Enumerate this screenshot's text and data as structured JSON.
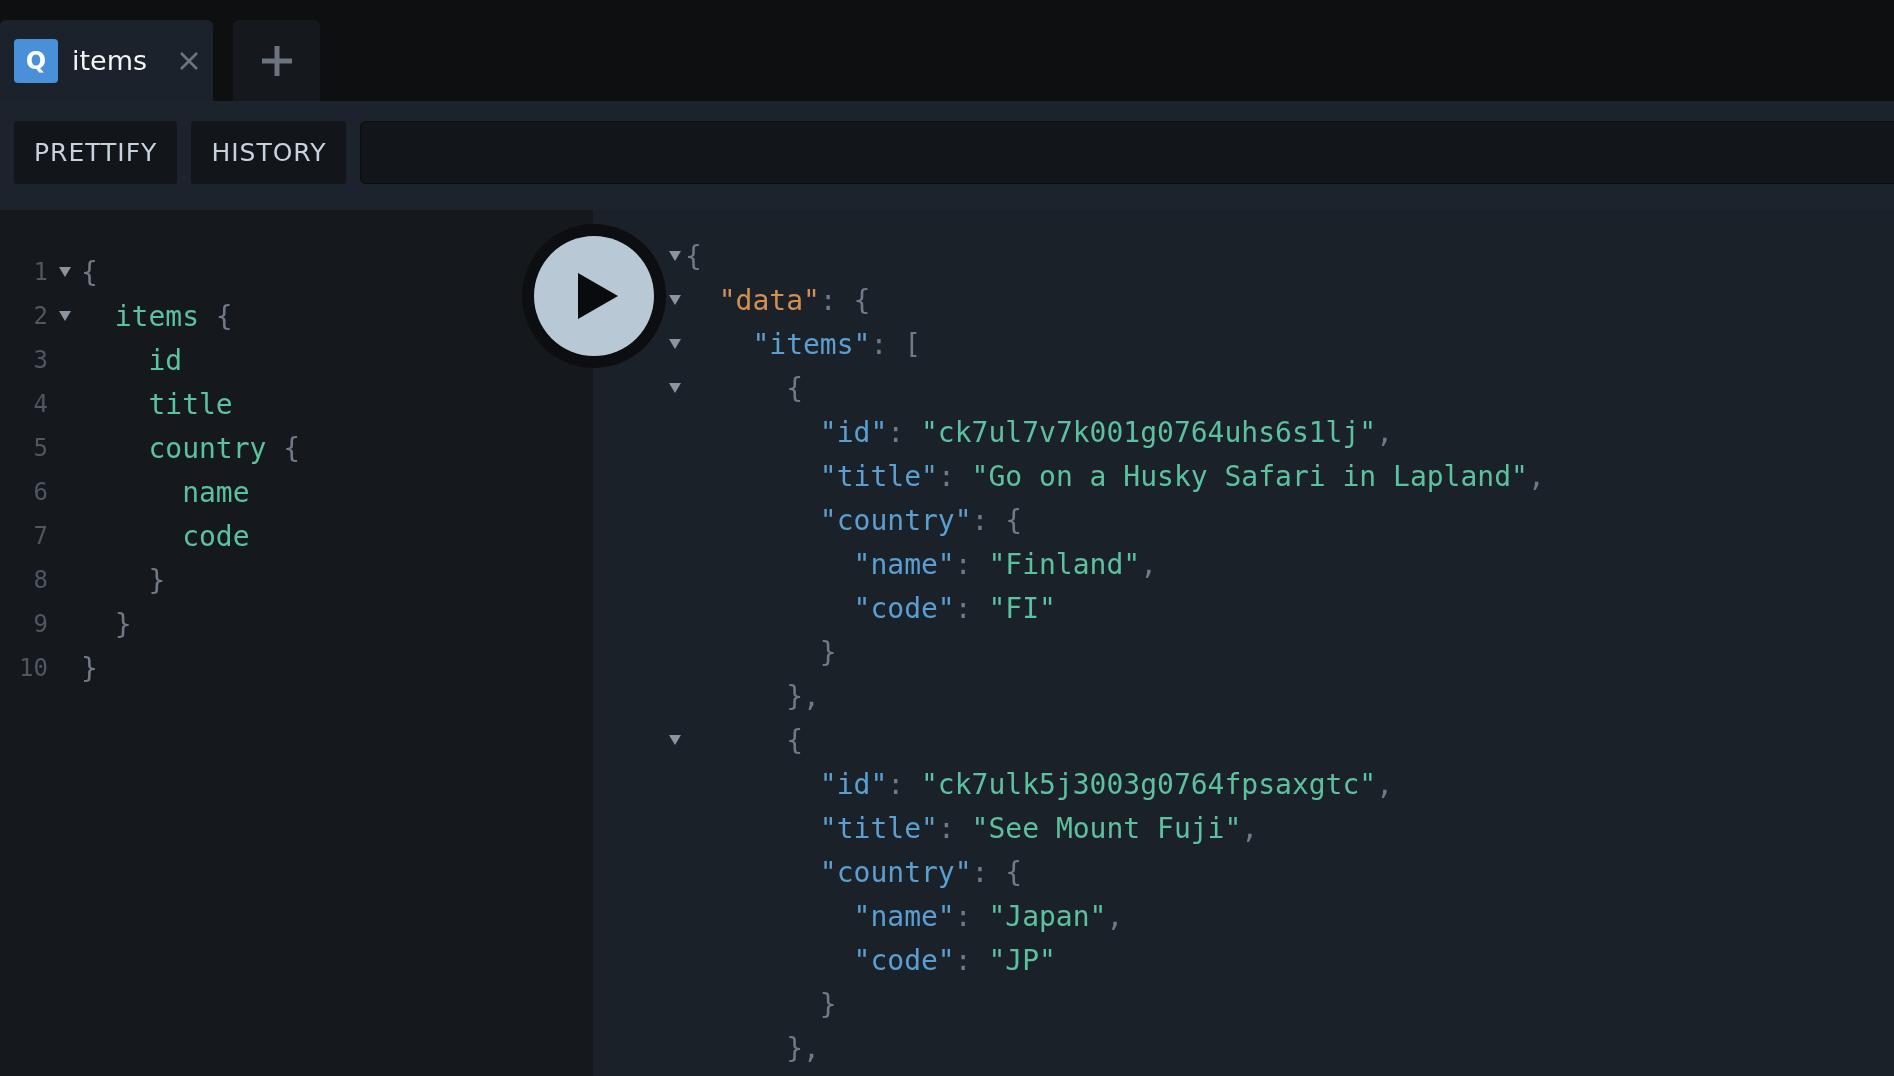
{
  "tabs": [
    {
      "badge": "Q",
      "label": "items",
      "selected": true
    }
  ],
  "toolbar": {
    "buttons": [
      "PRETTIFY",
      "HISTORY"
    ]
  },
  "query_editor": {
    "lines": [
      {
        "number": "1",
        "foldable": true,
        "tokens": [
          {
            "kind": "punct",
            "text": "{"
          }
        ],
        "children": [
          {
            "number": "2",
            "foldable": true,
            "tokens": [
              {
                "kind": "field",
                "text": "items"
              },
              {
                "kind": "punct",
                "text": " {"
              }
            ],
            "children": [
              {
                "number": "3",
                "foldable": false,
                "tokens": [
                  {
                    "kind": "field",
                    "text": "id"
                  }
                ]
              },
              {
                "number": "4",
                "foldable": false,
                "tokens": [
                  {
                    "kind": "field",
                    "text": "title"
                  }
                ]
              },
              {
                "number": "5",
                "foldable": false,
                "tokens": [
                  {
                    "kind": "field",
                    "text": "country"
                  },
                  {
                    "kind": "punct",
                    "text": " {"
                  }
                ],
                "children": [
                  {
                    "number": "6",
                    "foldable": false,
                    "tokens": [
                      {
                        "kind": "field",
                        "text": "name"
                      }
                    ]
                  },
                  {
                    "number": "7",
                    "foldable": false,
                    "tokens": [
                      {
                        "kind": "field",
                        "text": "code"
                      }
                    ]
                  }
                ],
                "end": {
                  "number": "8",
                  "tokens": [
                    {
                      "kind": "punct",
                      "text": "}"
                    }
                  ]
                }
              }
            ],
            "end": {
              "number": "9",
              "tokens": [
                {
                  "kind": "punct",
                  "text": "}"
                }
              ]
            }
          }
        ],
        "end": {
          "number": "10",
          "tokens": [
            {
              "kind": "punct",
              "text": "}"
            }
          ]
        }
      }
    ]
  },
  "result": {
    "lines": [
      {
        "foldable": true,
        "tokens": [
          {
            "kind": "punct",
            "text": "{"
          }
        ],
        "children": [
          {
            "foldable": true,
            "tokens": [
              {
                "kind": "root_key",
                "text": "\"data\""
              },
              {
                "kind": "punct",
                "text": ": {"
              }
            ],
            "children": [
              {
                "foldable": true,
                "tokens": [
                  {
                    "kind": "key",
                    "text": "\"items\""
                  },
                  {
                    "kind": "punct",
                    "text": ": ["
                  }
                ],
                "children": [
                  {
                    "foldable": true,
                    "tokens": [
                      {
                        "kind": "punct",
                        "text": "{"
                      }
                    ],
                    "children": [
                      {
                        "foldable": false,
                        "tokens": [
                          {
                            "kind": "key",
                            "text": "\"id\""
                          },
                          {
                            "kind": "punct",
                            "text": ": "
                          },
                          {
                            "kind": "string",
                            "text": "\"ck7ul7v7k001g0764uhs6s1lj\""
                          },
                          {
                            "kind": "punct",
                            "text": ","
                          }
                        ]
                      },
                      {
                        "foldable": false,
                        "tokens": [
                          {
                            "kind": "key",
                            "text": "\"title\""
                          },
                          {
                            "kind": "punct",
                            "text": ": "
                          },
                          {
                            "kind": "string",
                            "text": "\"Go on a Husky Safari in Lapland\""
                          },
                          {
                            "kind": "punct",
                            "text": ","
                          }
                        ]
                      },
                      {
                        "foldable": false,
                        "tokens": [
                          {
                            "kind": "key",
                            "text": "\"country\""
                          },
                          {
                            "kind": "punct",
                            "text": ": {"
                          }
                        ],
                        "children": [
                          {
                            "foldable": false,
                            "tokens": [
                              {
                                "kind": "key",
                                "text": "\"name\""
                              },
                              {
                                "kind": "punct",
                                "text": ": "
                              },
                              {
                                "kind": "string",
                                "text": "\"Finland\""
                              },
                              {
                                "kind": "punct",
                                "text": ","
                              }
                            ]
                          },
                          {
                            "foldable": false,
                            "tokens": [
                              {
                                "kind": "key",
                                "text": "\"code\""
                              },
                              {
                                "kind": "punct",
                                "text": ": "
                              },
                              {
                                "kind": "string",
                                "text": "\"FI\""
                              }
                            ]
                          }
                        ],
                        "end": {
                          "tokens": [
                            {
                              "kind": "punct",
                              "text": "}"
                            }
                          ]
                        }
                      }
                    ],
                    "end": {
                      "tokens": [
                        {
                          "kind": "punct",
                          "text": "},"
                        }
                      ]
                    }
                  },
                  {
                    "foldable": true,
                    "tokens": [
                      {
                        "kind": "punct",
                        "text": "{"
                      }
                    ],
                    "children": [
                      {
                        "foldable": false,
                        "tokens": [
                          {
                            "kind": "key",
                            "text": "\"id\""
                          },
                          {
                            "kind": "punct",
                            "text": ": "
                          },
                          {
                            "kind": "string",
                            "text": "\"ck7ulk5j3003g0764fpsaxgtc\""
                          },
                          {
                            "kind": "punct",
                            "text": ","
                          }
                        ]
                      },
                      {
                        "foldable": false,
                        "tokens": [
                          {
                            "kind": "key",
                            "text": "\"title\""
                          },
                          {
                            "kind": "punct",
                            "text": ": "
                          },
                          {
                            "kind": "string",
                            "text": "\"See Mount Fuji\""
                          },
                          {
                            "kind": "punct",
                            "text": ","
                          }
                        ]
                      },
                      {
                        "foldable": false,
                        "tokens": [
                          {
                            "kind": "key",
                            "text": "\"country\""
                          },
                          {
                            "kind": "punct",
                            "text": ": {"
                          }
                        ],
                        "children": [
                          {
                            "foldable": false,
                            "tokens": [
                              {
                                "kind": "key",
                                "text": "\"name\""
                              },
                              {
                                "kind": "punct",
                                "text": ": "
                              },
                              {
                                "kind": "string",
                                "text": "\"Japan\""
                              },
                              {
                                "kind": "punct",
                                "text": ","
                              }
                            ]
                          },
                          {
                            "foldable": false,
                            "tokens": [
                              {
                                "kind": "key",
                                "text": "\"code\""
                              },
                              {
                                "kind": "punct",
                                "text": ": "
                              },
                              {
                                "kind": "string",
                                "text": "\"JP\""
                              }
                            ]
                          }
                        ],
                        "end": {
                          "tokens": [
                            {
                              "kind": "punct",
                              "text": "}"
                            }
                          ]
                        }
                      }
                    ],
                    "end": {
                      "tokens": [
                        {
                          "kind": "punct",
                          "text": "},"
                        }
                      ]
                    }
                  }
                ]
              }
            ]
          }
        ]
      }
    ]
  }
}
